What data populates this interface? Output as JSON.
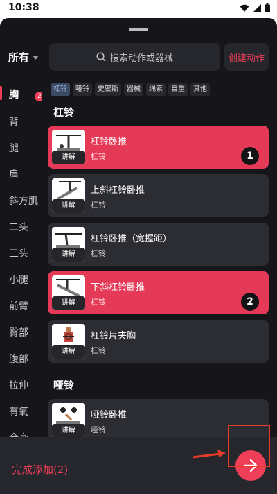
{
  "status": {
    "time": "10:38"
  },
  "header": {
    "filter_label": "所有",
    "search_placeholder": "搜索动作或器械",
    "create_label": "创建动作"
  },
  "equipment_tabs": [
    "杠铃",
    "哑铃",
    "史密斯",
    "器械",
    "绳索",
    "自重",
    "其他"
  ],
  "sidebar": {
    "items": [
      "胸",
      "背",
      "腿",
      "肩",
      "斜方肌",
      "二头",
      "三头",
      "小腿",
      "前臂",
      "臀部",
      "腹部",
      "拉伸",
      "有氧",
      "全身"
    ],
    "badge": "2"
  },
  "sections": {
    "barbell_title": "杠铃",
    "dumbbell_title": "哑铃"
  },
  "exercises": [
    {
      "name": "杠铃卧推",
      "equipment": "杠铃",
      "thumb_label": "讲解",
      "order": "1"
    },
    {
      "name": "上斜杠铃卧推",
      "equipment": "杠铃",
      "thumb_label": "讲解"
    },
    {
      "name": "杠铃卧推（宽握距）",
      "equipment": "杠铃",
      "thumb_label": "讲解"
    },
    {
      "name": "下斜杠铃卧推",
      "equipment": "杠铃",
      "thumb_label": "讲解",
      "order": "2"
    },
    {
      "name": "杠铃片夹胸",
      "equipment": "杠铃",
      "thumb_label": "讲解"
    },
    {
      "name": "哑铃卧推",
      "equipment": "哑铃",
      "thumb_label": "讲解"
    }
  ],
  "footer": {
    "done_label": "完成添加(2)"
  },
  "colors": {
    "accent": "#ee3e58",
    "selected_card": "#e43a57",
    "card": "#2c2d33",
    "background": "#16161a",
    "annotation": "#e53b28"
  },
  "icons": {
    "status": [
      "wifi-icon",
      "signal-icon",
      "battery-icon"
    ],
    "search": "search-icon",
    "dropdown": "caret-down-icon",
    "next": "arrow-right-icon"
  }
}
